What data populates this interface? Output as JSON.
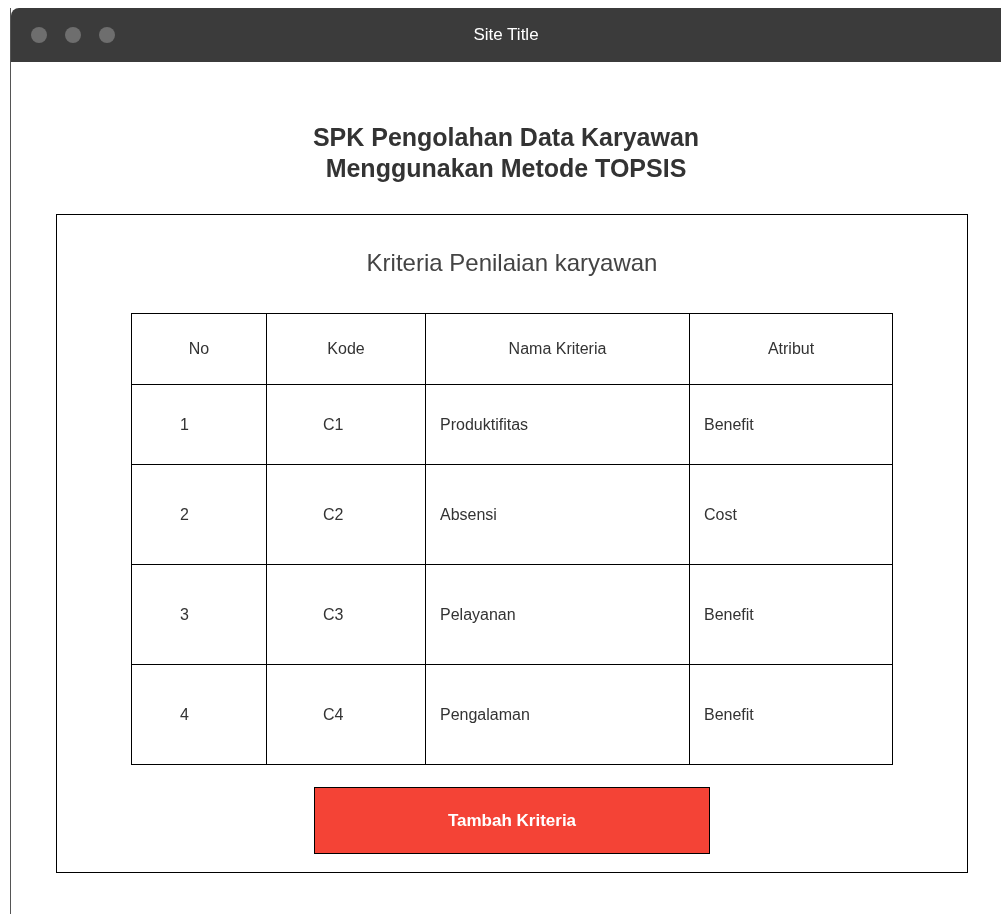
{
  "window": {
    "title": "Site Title"
  },
  "heading": [
    "SPK Pengolahan Data Karyawan",
    "Menggunakan Metode TOPSIS"
  ],
  "panel": {
    "title": "Kriteria Penilaian karyawan",
    "table": {
      "columns": [
        "No",
        "Kode",
        "Nama Kriteria",
        "Atribut"
      ],
      "rows": [
        [
          "1",
          "C1",
          "Produktifitas",
          "Benefit"
        ],
        [
          "2",
          "C2",
          "Absensi",
          "Cost"
        ],
        [
          "3",
          "C3",
          "Pelayanan",
          "Benefit"
        ],
        [
          "4",
          "C4",
          "Pengalaman",
          "Benefit"
        ]
      ]
    },
    "button": "Tambah Kriteria"
  }
}
